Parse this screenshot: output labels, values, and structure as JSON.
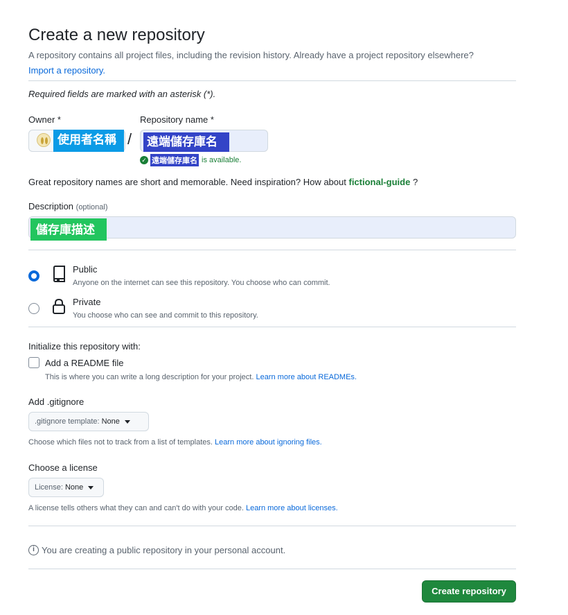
{
  "header": {
    "title": "Create a new repository",
    "subtitle": "A repository contains all project files, including the revision history. Already have a project repository elsewhere?",
    "import_link": "Import a repository."
  },
  "required_note": "Required fields are marked with an asterisk (*).",
  "owner": {
    "label": "Owner *",
    "value": "使用者名稱"
  },
  "slash": "/",
  "repository": {
    "label": "Repository name *",
    "value": "遠端儲存庫名",
    "availability_name": "遠端儲存庫名",
    "availability_text": "is available."
  },
  "inspiration": {
    "text": "Great repository names are short and memorable. Need inspiration? How about",
    "suggestion": "fictional-guide",
    "suffix": "?"
  },
  "description": {
    "label": "Description",
    "optional": "(optional)",
    "value": "儲存庫描述"
  },
  "visibility": {
    "public": {
      "title": "Public",
      "description": "Anyone on the internet can see this repository. You choose who can commit.",
      "selected": true
    },
    "private": {
      "title": "Private",
      "description": "You choose who can see and commit to this repository.",
      "selected": false
    }
  },
  "initialize": {
    "heading": "Initialize this repository with:",
    "readme_label": "Add a README file",
    "readme_checked": false,
    "readme_hint": "This is where you can write a long description for your project.",
    "readme_link": "Learn more about READMEs."
  },
  "gitignore": {
    "heading": "Add .gitignore",
    "select_prefix": ".gitignore template:",
    "select_value": "None",
    "hint": "Choose which files not to track from a list of templates.",
    "link": "Learn more about ignoring files."
  },
  "license": {
    "heading": "Choose a license",
    "select_prefix": "License:",
    "select_value": "None",
    "hint": "A license tells others what they can and can't do with your code.",
    "link": "Learn more about licenses."
  },
  "info_text": "You are creating a public repository in your personal account.",
  "submit_label": "Create repository",
  "colors": {
    "primary_button": "#1f883d",
    "link": "#0969da",
    "success": "#1a7f37",
    "owner_highlight": "#0b9be6",
    "repo_highlight": "#3344c7",
    "description_highlight": "#22c55e"
  },
  "icons": {
    "public": "repo-icon",
    "private": "lock-icon",
    "available": "check-circle-icon",
    "info": "info-icon"
  }
}
